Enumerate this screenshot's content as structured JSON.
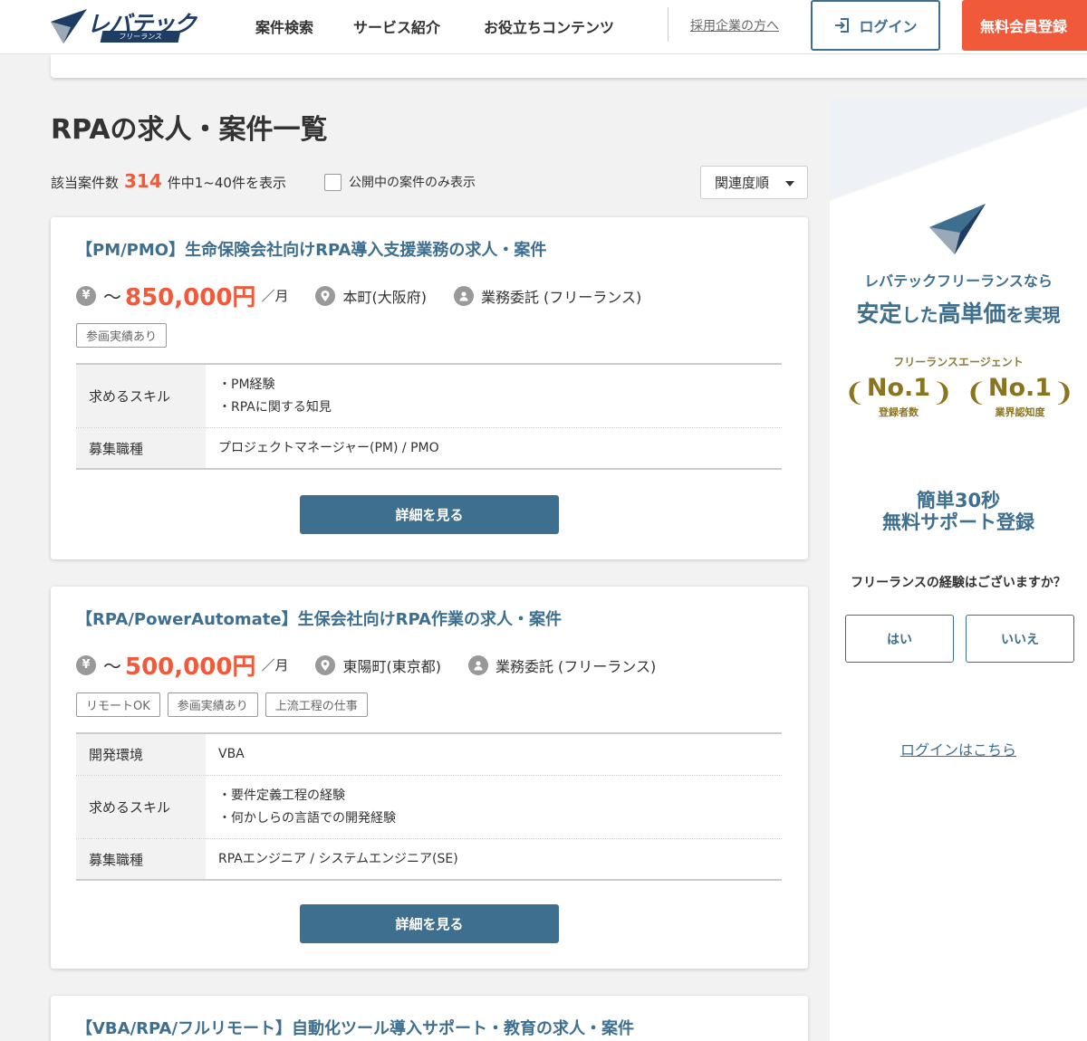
{
  "header": {
    "logo_text": "レバテック",
    "logo_sub": "フリーランス",
    "nav": [
      "案件検索",
      "サービス紹介",
      "お役立ちコンテンツ"
    ],
    "employer_link": "採用企業の方へ",
    "login_label": "ログイン",
    "register_label": "無料会員登録"
  },
  "main": {
    "title": "RPAの求人・案件一覧",
    "result_prefix": "該当案件数",
    "result_count": "314",
    "result_suffix": "件中1~40件を表示",
    "public_only_label": "公開中の案件のみ表示",
    "sort_label": "関連度順"
  },
  "jobs": [
    {
      "title": "【PM/PMO】生命保険会社向けRPA導入支援業務の求人・案件",
      "yen_icon": "¥",
      "tilde": "～",
      "price": "850,000円",
      "per": "／月",
      "location": "本町(大阪府)",
      "contract": "業務委託 (フリーランス)",
      "tags": [
        "参画実績あり"
      ],
      "rows": [
        {
          "label": "求めるスキル",
          "values": [
            "・PM経験",
            "・RPAに関する知見"
          ]
        },
        {
          "label": "募集職種",
          "values": [
            "プロジェクトマネージャー(PM) / PMO"
          ]
        }
      ],
      "button": "詳細を見る"
    },
    {
      "title": "【RPA/PowerAutomate】生保会社向けRPA作業の求人・案件",
      "yen_icon": "¥",
      "tilde": "～",
      "price": "500,000円",
      "per": "／月",
      "location": "東陽町(東京都)",
      "contract": "業務委託 (フリーランス)",
      "tags": [
        "リモートOK",
        "参画実績あり",
        "上流工程の仕事"
      ],
      "rows": [
        {
          "label": "開発環境",
          "values": [
            "VBA"
          ]
        },
        {
          "label": "求めるスキル",
          "values": [
            "・要件定義工程の経験",
            "・何かしらの言語での開発経験"
          ]
        },
        {
          "label": "募集職種",
          "values": [
            "RPAエンジニア / システムエンジニア(SE)"
          ]
        }
      ],
      "button": "詳細を見る"
    },
    {
      "title": "【VBA/RPA/フルリモート】自動化ツール導入サポート・教育の求人・案件"
    }
  ],
  "sidebar": {
    "line1": "レバテックフリーランスなら",
    "line2_a": "安定",
    "line2_b": "した",
    "line2_c": "高単価",
    "line2_d": "を実現",
    "agent_label": "フリーランスエージェント",
    "award1_title": "No.1",
    "award1_sub": "登録者数",
    "award2_title": "No.1",
    "award2_sub": "業界認知度",
    "register_line1": "簡単30秒",
    "register_line2": "無料サポート登録",
    "question": "フリーランスの経験はございますか？",
    "yes_label": "はい",
    "no_label": "いいえ",
    "login_link": "ログインはこちら"
  },
  "colors": {
    "brand_blue": "#3f6f8f",
    "accent_red": "#f05a3a",
    "gold": "#8a7420"
  }
}
